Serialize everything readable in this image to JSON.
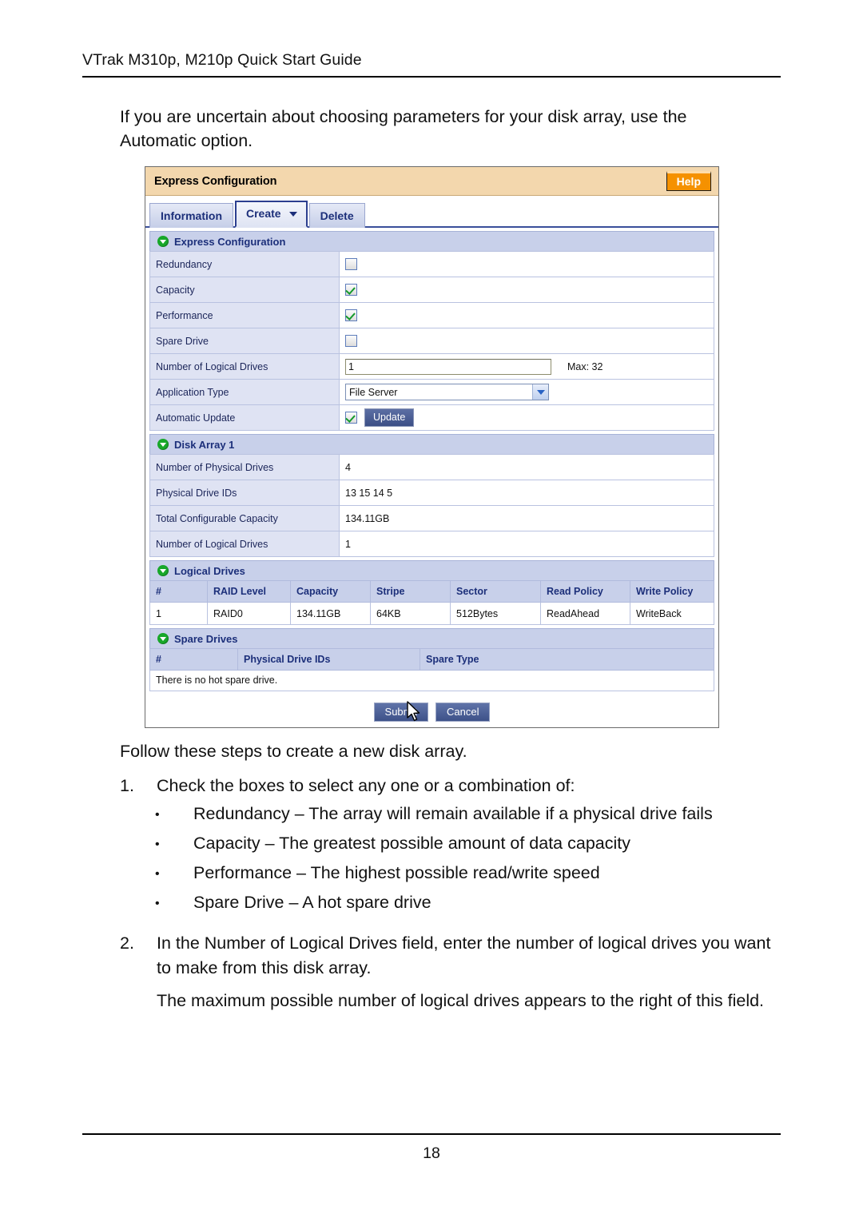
{
  "document": {
    "running_head": "VTrak M310p, M210p Quick Start Guide",
    "page_number": "18",
    "intro_paragraph": "If you are uncertain about choosing parameters for your disk array, use the Automatic option.",
    "lead_text": "Follow these steps to create a new disk array.",
    "steps": [
      {
        "number": "1.",
        "text": "Check the boxes to select any one or a combination of:",
        "bullets": [
          "Redundancy – The array will remain available if a physical drive fails",
          "Capacity – The greatest possible amount of data capacity",
          "Performance – The highest possible read/write speed",
          "Spare Drive – A hot spare drive"
        ]
      },
      {
        "number": "2.",
        "text": "In the Number of Logical Drives field, enter the number of logical drives you want to make from this disk array.",
        "sub_paragraph": "The maximum possible number of logical drives appears to the right of this field."
      }
    ],
    "bullet_glyph": "•"
  },
  "app": {
    "titlebar": {
      "title": "Express Configuration",
      "help_label": "Help",
      "background_color": "#f3d7ad",
      "help_color": "#f59100"
    },
    "tabs": [
      {
        "label": "Information",
        "active": false,
        "has_caret": false
      },
      {
        "label": "Create",
        "active": true,
        "has_caret": true
      },
      {
        "label": "Delete",
        "active": false,
        "has_caret": false
      }
    ],
    "sections": {
      "express_configuration": {
        "title": "Express Configuration",
        "rows": [
          {
            "label": "Redundancy",
            "type": "checkbox",
            "checked": false
          },
          {
            "label": "Capacity",
            "type": "checkbox",
            "checked": true
          },
          {
            "label": "Performance",
            "type": "checkbox",
            "checked": true
          },
          {
            "label": "Spare Drive",
            "type": "checkbox",
            "checked": false
          },
          {
            "label": "Number of Logical Drives",
            "type": "text",
            "value": "1",
            "note": "Max: 32"
          },
          {
            "label": "Application Type",
            "type": "select",
            "value": "File Server"
          },
          {
            "label": "Automatic Update",
            "type": "checkbox-button",
            "checked": true,
            "button_label": "Update"
          }
        ]
      },
      "disk_array": {
        "title": "Disk Array 1",
        "rows": [
          {
            "label": "Number of Physical Drives",
            "value": "4"
          },
          {
            "label": "Physical Drive IDs",
            "value": "13 15 14 5"
          },
          {
            "label": "Total Configurable Capacity",
            "value": "134.11GB"
          },
          {
            "label": "Number of Logical Drives",
            "value": "1"
          }
        ]
      },
      "logical_drives": {
        "title": "Logical Drives",
        "columns": [
          "#",
          "RAID Level",
          "Capacity",
          "Stripe",
          "Sector",
          "Read Policy",
          "Write Policy"
        ],
        "rows": [
          [
            "1",
            "RAID0",
            "134.11GB",
            "64KB",
            "512Bytes",
            "ReadAhead",
            "WriteBack"
          ]
        ]
      },
      "spare_drives": {
        "title": "Spare Drives",
        "columns": [
          "#",
          "Physical Drive IDs",
          "Spare Type"
        ],
        "empty_message": "There is no hot spare drive."
      }
    },
    "form_buttons": {
      "submit_label": "Submit",
      "cancel_label": "Cancel"
    }
  }
}
